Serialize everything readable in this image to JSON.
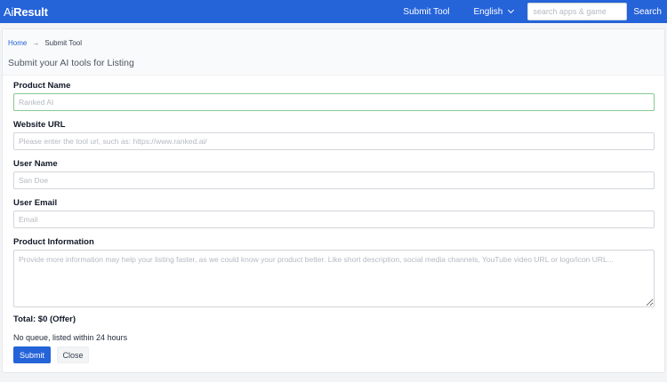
{
  "navbar": {
    "brand_prefix": "Ai",
    "brand_suffix": "Result",
    "submit_tool_label": "Submit Tool",
    "language_label": "English",
    "search_placeholder": "search apps & game",
    "search_button_label": "Search",
    "accent_color": "#2563d9"
  },
  "breadcrumb": {
    "home": "Home",
    "separator": "→",
    "current": "Submit Tool"
  },
  "page": {
    "title": "Submit your AI tools for Listing"
  },
  "form": {
    "product_name": {
      "label": "Product Name",
      "placeholder": "Ranked AI",
      "value": ""
    },
    "website_url": {
      "label": "Website URL",
      "placeholder": "Please enter the tool url, such as: https://www.ranked.ai/",
      "value": ""
    },
    "user_name": {
      "label": "User Name",
      "placeholder": "San Doe",
      "value": ""
    },
    "user_email": {
      "label": "User Email",
      "placeholder": "Email",
      "value": ""
    },
    "product_info": {
      "label": "Product Information",
      "placeholder": "Provide more information may help your listing faster, as we could know your product better. Like short description, social media channels, YouTube video URL or logo/icon URL...",
      "value": ""
    },
    "total": "Total: $0 (Offer)",
    "note": "No queue, listed within 24 hours",
    "submit_label": "Submit",
    "close_label": "Close"
  }
}
